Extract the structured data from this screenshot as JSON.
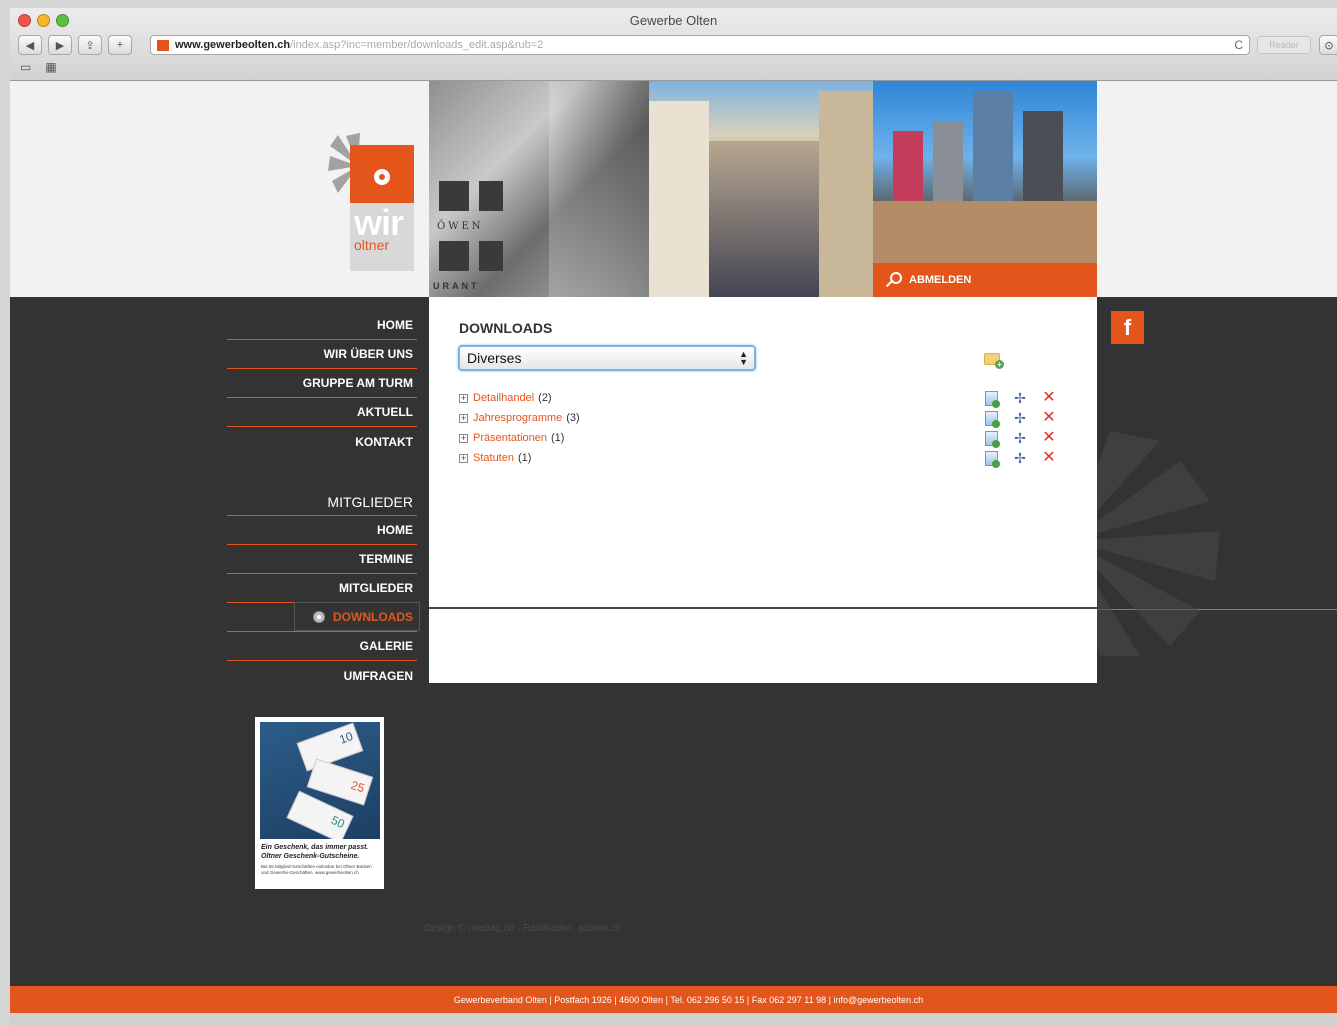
{
  "window": {
    "title": "Gewerbe Olten"
  },
  "browser": {
    "url_host": "www.gewerbeolten.ch",
    "url_path": "/index.asp?inc=member/downloads_edit.asp&rub=2",
    "reader_label": "Reader",
    "back": "◀",
    "forward": "▶",
    "share": "⇪",
    "add": "+",
    "reload": "C",
    "bookmarks": "▭",
    "grid": "▦",
    "downloads": "⊙"
  },
  "header": {
    "logo_text": "wir",
    "logo_sub": "oltner",
    "banner_sign_1": "ÖWEN",
    "banner_sign_2": "URANT",
    "abmelden": "ABMELDEN"
  },
  "nav": {
    "main": [
      "HOME",
      "WIR ÜBER UNS",
      "GRUPPE AM TURM",
      "AKTUELL",
      "KONTAKT"
    ],
    "members_heading": "MITGLIEDER",
    "members": [
      "HOME",
      "TERMINE",
      "MITGLIEDER",
      "DOWNLOADS",
      "GALERIE",
      "UMFRAGEN"
    ]
  },
  "content": {
    "title": "DOWNLOADS",
    "selected_category": "Diverses",
    "items": [
      {
        "label": "Detailhandel",
        "count": "(2)"
      },
      {
        "label": "Jahresprogramme",
        "count": "(3)"
      },
      {
        "label": "Präsentationen",
        "count": "(1)"
      },
      {
        "label": "Statuten",
        "count": "(1)"
      }
    ],
    "expander": "+",
    "move_icon": "✢",
    "delete_icon": "✕"
  },
  "social": {
    "facebook": "f"
  },
  "ad": {
    "caption": "Ein Geschenk, das immer passt. Oltner Geschenk-Gutscheine.",
    "small": "Bei 65 Mitglied-Geschäften einlösbar bei Oltner Banken und Gewerbe-Geschäften. www.gewerbeolten.ch",
    "note_values": [
      "10",
      "25",
      "50"
    ]
  },
  "credits": "Design © mediag.ch · Realisation: azoom.ch",
  "footer": "Gewerbeverband Olten | Postfach 1926 | 4600 Olten | Tel. 062 296 50 15 | Fax 062 297 11 98 | info@gewerbeolten.ch",
  "colors": {
    "accent": "#e4551c",
    "dark": "#333333",
    "link": "#e4551c"
  }
}
